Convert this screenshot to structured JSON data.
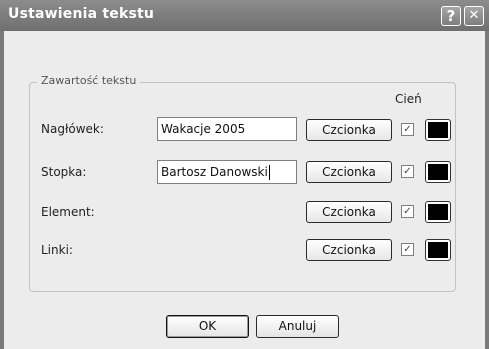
{
  "dialog": {
    "title": "Ustawienia tekstu",
    "help_glyph": "?",
    "close_glyph": "✕"
  },
  "group": {
    "title": "Zawartość tekstu",
    "shadow_header": "Cień"
  },
  "rows": [
    {
      "label": "Nagłówek:",
      "value": "Wakacje 2005",
      "font_button": "Czcionka",
      "shadow_checked": true,
      "color": "#000000"
    },
    {
      "label": "Stopka:",
      "value": "Bartosz Danowski",
      "font_button": "Czcionka",
      "shadow_checked": true,
      "color": "#000000"
    },
    {
      "label": "Element:",
      "font_button": "Czcionka",
      "shadow_checked": true,
      "color": "#000000"
    },
    {
      "label": "Linki:",
      "font_button": "Czcionka",
      "shadow_checked": true,
      "color": "#000000"
    }
  ],
  "footer": {
    "ok_label": "OK",
    "cancel_label": "Anuluj"
  },
  "icons": {
    "checkbox_checked": "✓"
  }
}
